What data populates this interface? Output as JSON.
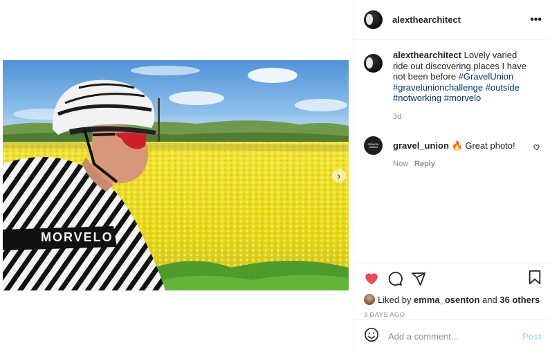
{
  "post": {
    "username": "alexthearchitect",
    "caption_text": "Lovely varied ride out discovering places I have not been before",
    "hashtags": [
      "#GravelUnion",
      "#gravelunionchallenge",
      "#outside",
      "#notworking",
      "#morvelo"
    ],
    "age": "3d",
    "photo_jersey_text": "MORVELO"
  },
  "comments": [
    {
      "username": "gravel_union",
      "emoji": "🔥",
      "text": "Great photo!",
      "time": "Now",
      "reply_label": "Reply",
      "avatar_text": "GRAVEL UNION"
    }
  ],
  "likes": {
    "prefix": "Liked by",
    "user": "emma_osenton",
    "and": "and",
    "others": "36 others"
  },
  "date": "3 DAYS AGO",
  "add_comment": {
    "placeholder": "Add a comment...",
    "post_label": "Post"
  },
  "icons": {
    "more": "more-options-icon",
    "like": "heart-filled-icon",
    "comment": "comment-icon",
    "share": "paper-plane-icon",
    "save": "bookmark-icon",
    "emoji": "smiley-icon",
    "next": "chevron-right-icon"
  },
  "colors": {
    "like_red": "#ed4956",
    "hashtag_blue": "#00376b",
    "post_disabled": "#b2dffc",
    "muted": "#8e8e8e"
  }
}
